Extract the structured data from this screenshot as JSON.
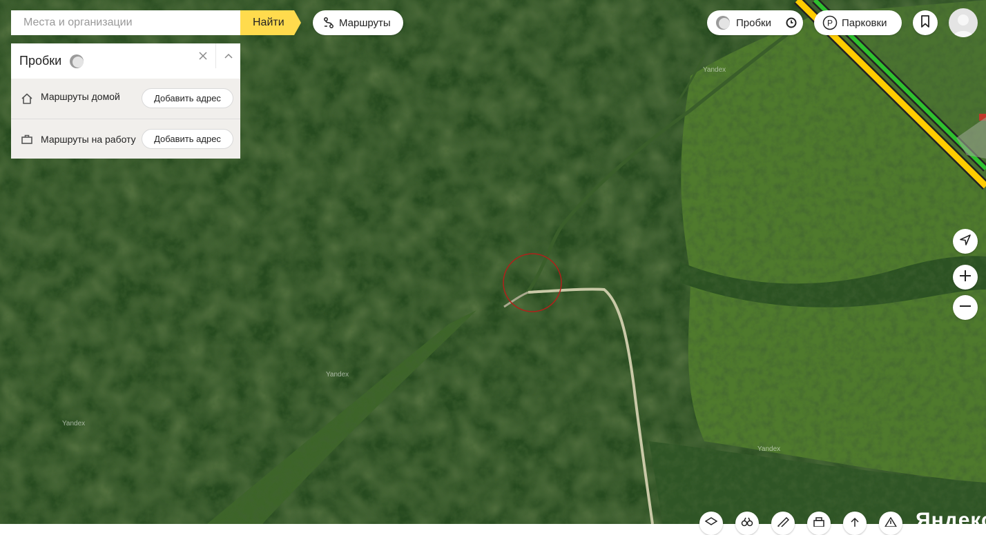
{
  "search": {
    "placeholder": "Места и организации",
    "find_label": "Найти"
  },
  "toolbar": {
    "routes_label": "Маршруты",
    "traffic_label": "Пробки",
    "parking_label": "Парковки"
  },
  "traffic_panel": {
    "title": "Пробки",
    "rows": [
      {
        "label": "Маршруты домой",
        "button": "Добавить адрес",
        "icon": "home-icon"
      },
      {
        "label": "Маршруты на работу",
        "button": "Добавить адрес",
        "icon": "briefcase-icon"
      }
    ]
  },
  "map": {
    "watermarks": [
      "Yandex",
      "Yandex",
      "Yandex",
      "Yandex"
    ],
    "brand": "Яндекс",
    "marker_color": "#b0201a",
    "road_colors": {
      "highway_fill": "#ffcc00",
      "traffic_free": "#2ec02e"
    }
  },
  "map_controls": [
    "locate-icon",
    "zoom-in-icon",
    "zoom-out-icon"
  ],
  "bottom_tools": [
    "layers-icon",
    "panorama-icon",
    "ruler-icon",
    "print-icon",
    "share-icon",
    "feedback-icon"
  ],
  "colors": {
    "accent": "#ffdb4d"
  }
}
